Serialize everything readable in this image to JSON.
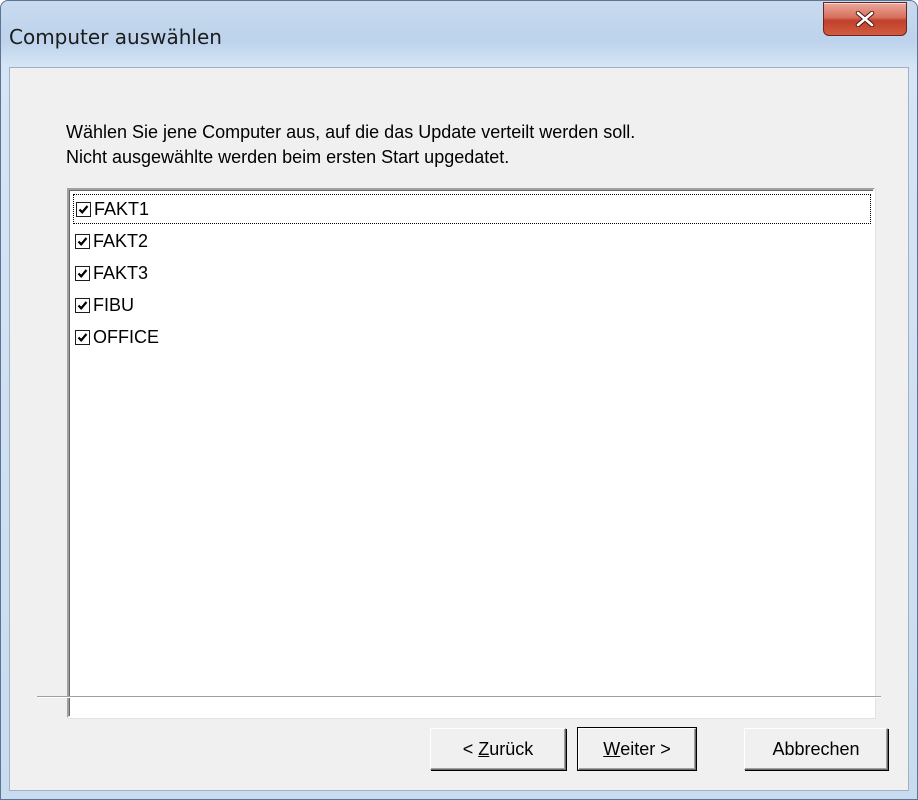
{
  "window": {
    "title": "Computer auswählen"
  },
  "instructions": {
    "line1": "Wählen Sie jene Computer aus, auf die das Update verteilt werden soll.",
    "line2": "Nicht ausgewählte werden beim ersten Start upgedatet."
  },
  "computers": [
    {
      "label": "FAKT1",
      "checked": true,
      "focused": true
    },
    {
      "label": "FAKT2",
      "checked": true,
      "focused": false
    },
    {
      "label": "FAKT3",
      "checked": true,
      "focused": false
    },
    {
      "label": "FIBU",
      "checked": true,
      "focused": false
    },
    {
      "label": "OFFICE",
      "checked": true,
      "focused": false
    }
  ],
  "buttons": {
    "back_prefix": "< ",
    "back_mnemonic": "Z",
    "back_rest": "urück",
    "next_mnemonic": "W",
    "next_rest": "eiter >",
    "cancel": "Abbrechen"
  },
  "colors": {
    "titlebar": "#bdd3ec",
    "close_button": "#c0402c",
    "dialog_background": "#f0f0f0"
  },
  "icons": {
    "close": "close-icon",
    "check": "checkmark-icon"
  }
}
